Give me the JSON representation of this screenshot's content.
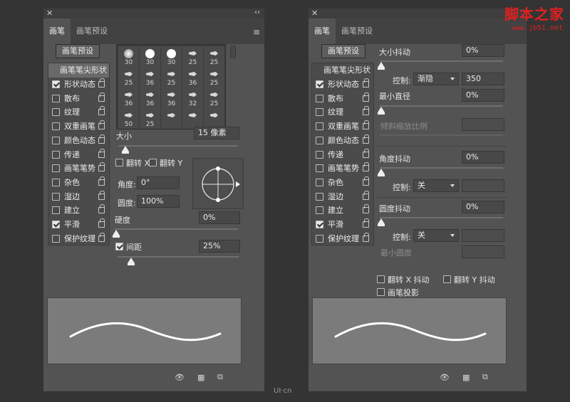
{
  "left_panel": {
    "tabs": [
      "画笔",
      "画笔预设"
    ],
    "presets_button": "画笔预设",
    "list_header": "画笔笔尖形状",
    "items": [
      {
        "label": "形状动态",
        "checked": true
      },
      {
        "label": "散布",
        "checked": false
      },
      {
        "label": "纹理",
        "checked": false
      },
      {
        "label": "双重画笔",
        "checked": false
      },
      {
        "label": "颜色动态",
        "checked": false
      },
      {
        "label": "传递",
        "checked": false
      },
      {
        "label": "画笔笔势",
        "checked": false
      },
      {
        "label": "杂色",
        "checked": false
      },
      {
        "label": "湿边",
        "checked": false
      },
      {
        "label": "建立",
        "checked": false
      },
      {
        "label": "平滑",
        "checked": true
      },
      {
        "label": "保护纹理",
        "checked": false
      }
    ],
    "brush_sizes": [
      "30",
      "30",
      "30",
      "25",
      "25",
      "25",
      "36",
      "25",
      "36",
      "25",
      "36",
      "36",
      "36",
      "32",
      "25",
      "50",
      "25",
      "",
      "",
      "",
      "",
      ""
    ],
    "size_label": "大小",
    "size_value": "15 像素",
    "flip_x": "翻转 X",
    "flip_y": "翻转 Y",
    "angle_label": "角度:",
    "angle_value": "0°",
    "roundness_label": "圆度:",
    "roundness_value": "100%",
    "hardness_label": "硬度",
    "hardness_value": "0%",
    "spacing_label": "间距",
    "spacing_value": "25%"
  },
  "right_panel": {
    "tabs": [
      "画笔",
      "画笔预设"
    ],
    "presets_button": "画笔预设",
    "list_header": "画笔笔尖形状",
    "items": [
      {
        "label": "形状动态",
        "checked": true
      },
      {
        "label": "散布",
        "checked": false
      },
      {
        "label": "纹理",
        "checked": false
      },
      {
        "label": "双重画笔",
        "checked": false
      },
      {
        "label": "颜色动态",
        "checked": false
      },
      {
        "label": "传递",
        "checked": false
      },
      {
        "label": "画笔笔势",
        "checked": false
      },
      {
        "label": "杂色",
        "checked": false
      },
      {
        "label": "湿边",
        "checked": false
      },
      {
        "label": "建立",
        "checked": false
      },
      {
        "label": "平滑",
        "checked": true
      },
      {
        "label": "保护纹理",
        "checked": false
      }
    ],
    "size_jitter_label": "大小抖动",
    "size_jitter_value": "0%",
    "control_label": "控制:",
    "control1_value": "渐隐",
    "control1_number": "350",
    "min_diameter_label": "最小直径",
    "min_diameter_value": "0%",
    "tilt_scale_label": "倾斜缩放比例",
    "angle_jitter_label": "角度抖动",
    "angle_jitter_value": "0%",
    "control2_value": "关",
    "roundness_jitter_label": "圆度抖动",
    "roundness_jitter_value": "0%",
    "control3_value": "关",
    "min_roundness_label": "最小圆度",
    "flip_x_jitter": "翻转 X 抖动",
    "flip_y_jitter": "翻转 Y 抖动",
    "brush_projection": "画笔投影"
  },
  "watermark": {
    "text": "脚本之家",
    "url": "www.jb51.net",
    "bottom": "UI·cn"
  }
}
